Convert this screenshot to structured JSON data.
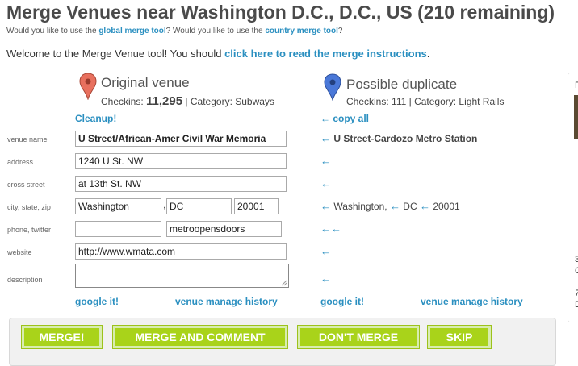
{
  "page": {
    "title": "Merge Venues near Washington D.C., D.C., US (210 remaining)",
    "subline": {
      "prefix": "Would you like to use the ",
      "global_link": "global merge tool",
      "middle": "? Would you like to use the ",
      "country_link": "country merge tool",
      "suffix": "?"
    },
    "welcome": {
      "text": "Welcome to the Merge Venue tool! You should ",
      "link": "click here to read the merge instructions",
      "suffix": "."
    }
  },
  "original": {
    "heading": "Original venue",
    "checkins_label": "Checkins: ",
    "checkins_value": "11,295",
    "category": " | Category: Subways",
    "cleanup": "Cleanup!",
    "pin_color": "#e8705e"
  },
  "duplicate": {
    "heading": "Possible duplicate",
    "checkins_label": "Checkins: ",
    "checkins_value": "111",
    "category": " | Category: Light Rails",
    "copy_all": "← copy all",
    "pin_color": "#4a78d8",
    "name": "U Street-Cardozo Metro Station",
    "city_parts": [
      "Washington,",
      "DC",
      "20001"
    ]
  },
  "labels": {
    "venue_name": "venue name",
    "address": "address",
    "cross_street": "cross street",
    "city_state_zip": "city, state, zip",
    "phone_twitter": "phone, twitter",
    "website": "website",
    "description": "description"
  },
  "fields": {
    "venue_name": "U Street/African-Amer Civil War Memoria",
    "address": "1240 U St. NW",
    "cross_street": "at 13th St. NW",
    "city": "Washington",
    "comma": ",",
    "state": "DC",
    "zip": "20001",
    "phone": "",
    "twitter": "metroopensdoors",
    "website": "http://www.wmata.com",
    "description": ""
  },
  "arrow": "←",
  "links": {
    "google": "google it!",
    "history": "venue manage history"
  },
  "buttons": {
    "merge": "MERGE!",
    "merge_comment": "MERGE AND COMMENT",
    "dont_merge": "DON'T MERGE",
    "skip": "SKIP"
  },
  "right_panel": {
    "top_letter": "P",
    "t1": "3",
    "t2": "C",
    "t3": "7",
    "t4": "D"
  },
  "colors": {
    "link": "#2a8fc0",
    "button": "#a9d31a"
  }
}
